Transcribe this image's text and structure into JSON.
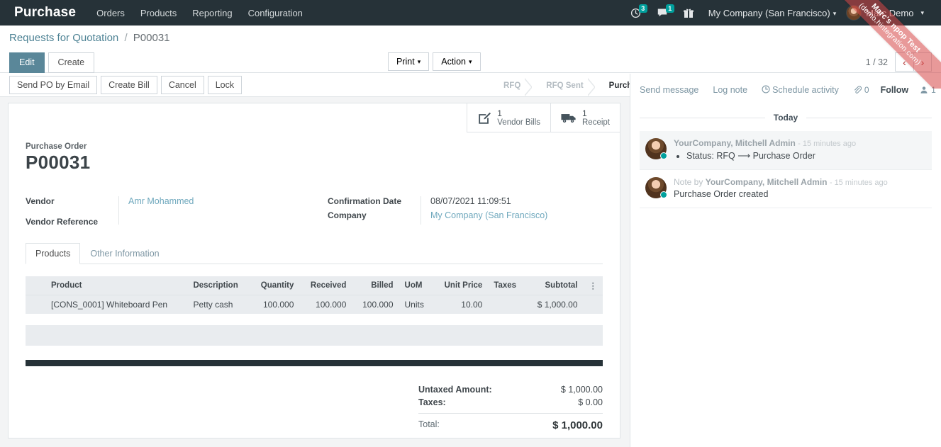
{
  "navbar": {
    "brand": "Purchase",
    "menu": [
      {
        "label": "Orders"
      },
      {
        "label": "Products"
      },
      {
        "label": "Reporting"
      },
      {
        "label": "Configuration"
      }
    ],
    "systray": {
      "activity_count": "3",
      "messaging_count": "1",
      "gift_icon": "gift-icon"
    },
    "company": "My Company (San Francisco)",
    "user": "Marc Demo"
  },
  "watermark": {
    "line1": "Marc's npop Test",
    "line2": "(demo.hintegration.com)"
  },
  "control_panel": {
    "breadcrumb_root": "Requests for Quotation",
    "breadcrumb_sep": "/",
    "breadcrumb_current": "P00031",
    "edit_label": "Edit",
    "create_label": "Create",
    "print_label": "Print",
    "action_label": "Action",
    "pager": "1 / 32",
    "prev_icon": "‹",
    "next_icon": "›"
  },
  "statusbar": {
    "buttons": [
      {
        "label": "Send PO by Email"
      },
      {
        "label": "Create Bill"
      },
      {
        "label": "Cancel"
      },
      {
        "label": "Lock"
      }
    ],
    "stages": [
      {
        "label": "RFQ",
        "state": "done"
      },
      {
        "label": "RFQ Sent",
        "state": "done"
      },
      {
        "label": "Purchase Order",
        "state": "active"
      }
    ]
  },
  "smart_buttons": [
    {
      "icon": "pencil-square-icon",
      "count": "1",
      "label": "Vendor Bills"
    },
    {
      "icon": "truck-icon",
      "count": "1",
      "label": "Receipt"
    }
  ],
  "form": {
    "subtitle": "Purchase Order",
    "title": "P00031",
    "left_fields": [
      {
        "label": "Vendor",
        "value": "Amr Mohammed",
        "link": true
      },
      {
        "label": "Vendor Reference",
        "value": "",
        "link": false
      }
    ],
    "right_fields": [
      {
        "label": "Confirmation Date",
        "value": "08/07/2021 11:09:51",
        "link": false
      },
      {
        "label": "Company",
        "value": "My Company (San Francisco)",
        "link": true
      }
    ],
    "tabs": [
      {
        "label": "Products",
        "active": true
      },
      {
        "label": "Other Information",
        "active": false
      }
    ]
  },
  "lines": {
    "columns": [
      "Product",
      "Description",
      "Quantity",
      "Received",
      "Billed",
      "UoM",
      "Unit Price",
      "Taxes",
      "Subtotal"
    ],
    "optional_col_icon": "⋮",
    "rows": [
      {
        "product": "[CONS_0001] Whiteboard Pen",
        "description": "Petty cash",
        "quantity": "100.000",
        "received": "100.000",
        "billed": "100.000",
        "uom": "Units",
        "unit_price": "10.00",
        "taxes": "",
        "subtotal": "$ 1,000.00"
      }
    ]
  },
  "totals": {
    "untaxed_label": "Untaxed Amount:",
    "untaxed_value": "$ 1,000.00",
    "taxes_label": "Taxes:",
    "taxes_value": "$ 0.00",
    "total_label": "Total:",
    "total_value": "$ 1,000.00"
  },
  "chatter": {
    "send_message": "Send message",
    "log_note": "Log note",
    "schedule_activity": "Schedule activity",
    "attachment_count": "0",
    "follow_label": "Follow",
    "followers_count": "1",
    "day_separator": "Today",
    "messages": [
      {
        "author": "YourCompany, Mitchell Admin",
        "prefix": "",
        "time": "- 15 minutes ago",
        "body": "Status: RFQ ⟶ Purchase Order",
        "bulleted": true,
        "shaded": true
      },
      {
        "author": "YourCompany, Mitchell Admin",
        "prefix": "Note by ",
        "time": "- 15 minutes ago",
        "body": "Purchase Order created",
        "bulleted": false,
        "shaded": false
      }
    ]
  },
  "colors": {
    "navbar_bg": "#263238",
    "accent": "#00A09D",
    "primary_btn": "#5a8799",
    "link": "#6fa8bd",
    "table_head": "#e9ecef"
  }
}
